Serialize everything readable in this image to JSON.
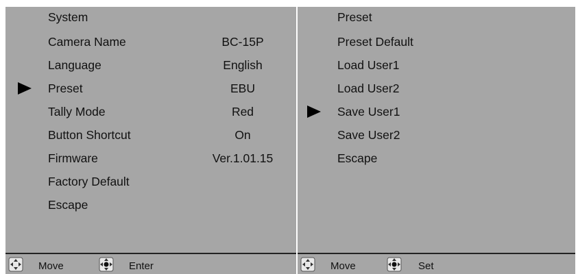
{
  "left_menu": {
    "title": "System",
    "items": [
      {
        "label": "Camera Name",
        "value": "BC-15P"
      },
      {
        "label": "Language",
        "value": "English"
      },
      {
        "label": "Preset",
        "value": "EBU",
        "selected": true
      },
      {
        "label": "Tally Mode",
        "value": "Red"
      },
      {
        "label": "Button Shortcut",
        "value": "On"
      },
      {
        "label": "Firmware",
        "value": "Ver.1.01.15"
      },
      {
        "label": "Factory Default",
        "value": ""
      },
      {
        "label": "Escape",
        "value": ""
      }
    ],
    "footer": {
      "move_label": "Move",
      "enter_label": "Enter"
    }
  },
  "right_menu": {
    "title": "Preset",
    "items": [
      {
        "label": "Preset Default"
      },
      {
        "label": "Load User1"
      },
      {
        "label": "Load User2"
      },
      {
        "label": "Save User1",
        "selected": true
      },
      {
        "label": "Save User2"
      },
      {
        "label": "Escape"
      }
    ],
    "footer": {
      "move_label": "Move",
      "set_label": "Set"
    }
  },
  "colors": {
    "panel_bg": "#a6a6a6",
    "text": "#111111",
    "cursor": "#000000"
  },
  "icons": {
    "move": "joystick-move-icon",
    "enter": "joystick-press-icon",
    "cursor": "selection-arrow-icon"
  }
}
